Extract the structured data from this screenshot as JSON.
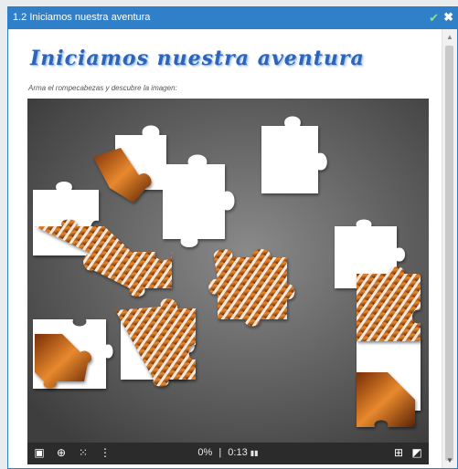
{
  "window": {
    "title": "1.2 Iniciamos nuestra aventura"
  },
  "activity": {
    "heading": "Iniciamos nuestra aventura",
    "instruction": "Arma el rompecabezas y descubre la imagen:"
  },
  "puzzle": {
    "progress": "0%",
    "separator": "|",
    "timer": "0:13"
  },
  "icons": {
    "confirm": "check-icon",
    "close": "close-icon",
    "image_preview": "image-icon",
    "ghost_image": "target-icon",
    "shuffle": "grid-icon",
    "more": "more-icon",
    "timer_pause": "pause-icon",
    "reset": "reset-icon",
    "fullscreen": "fullscreen-icon"
  },
  "colors": {
    "titlebar": "#2f80c8",
    "heading": "#2e64b8",
    "board_bg": "#6c6c6c",
    "piece_orange": "#c8661c",
    "piece_white": "#ffffff",
    "statusbar": "#2b2b2b"
  }
}
